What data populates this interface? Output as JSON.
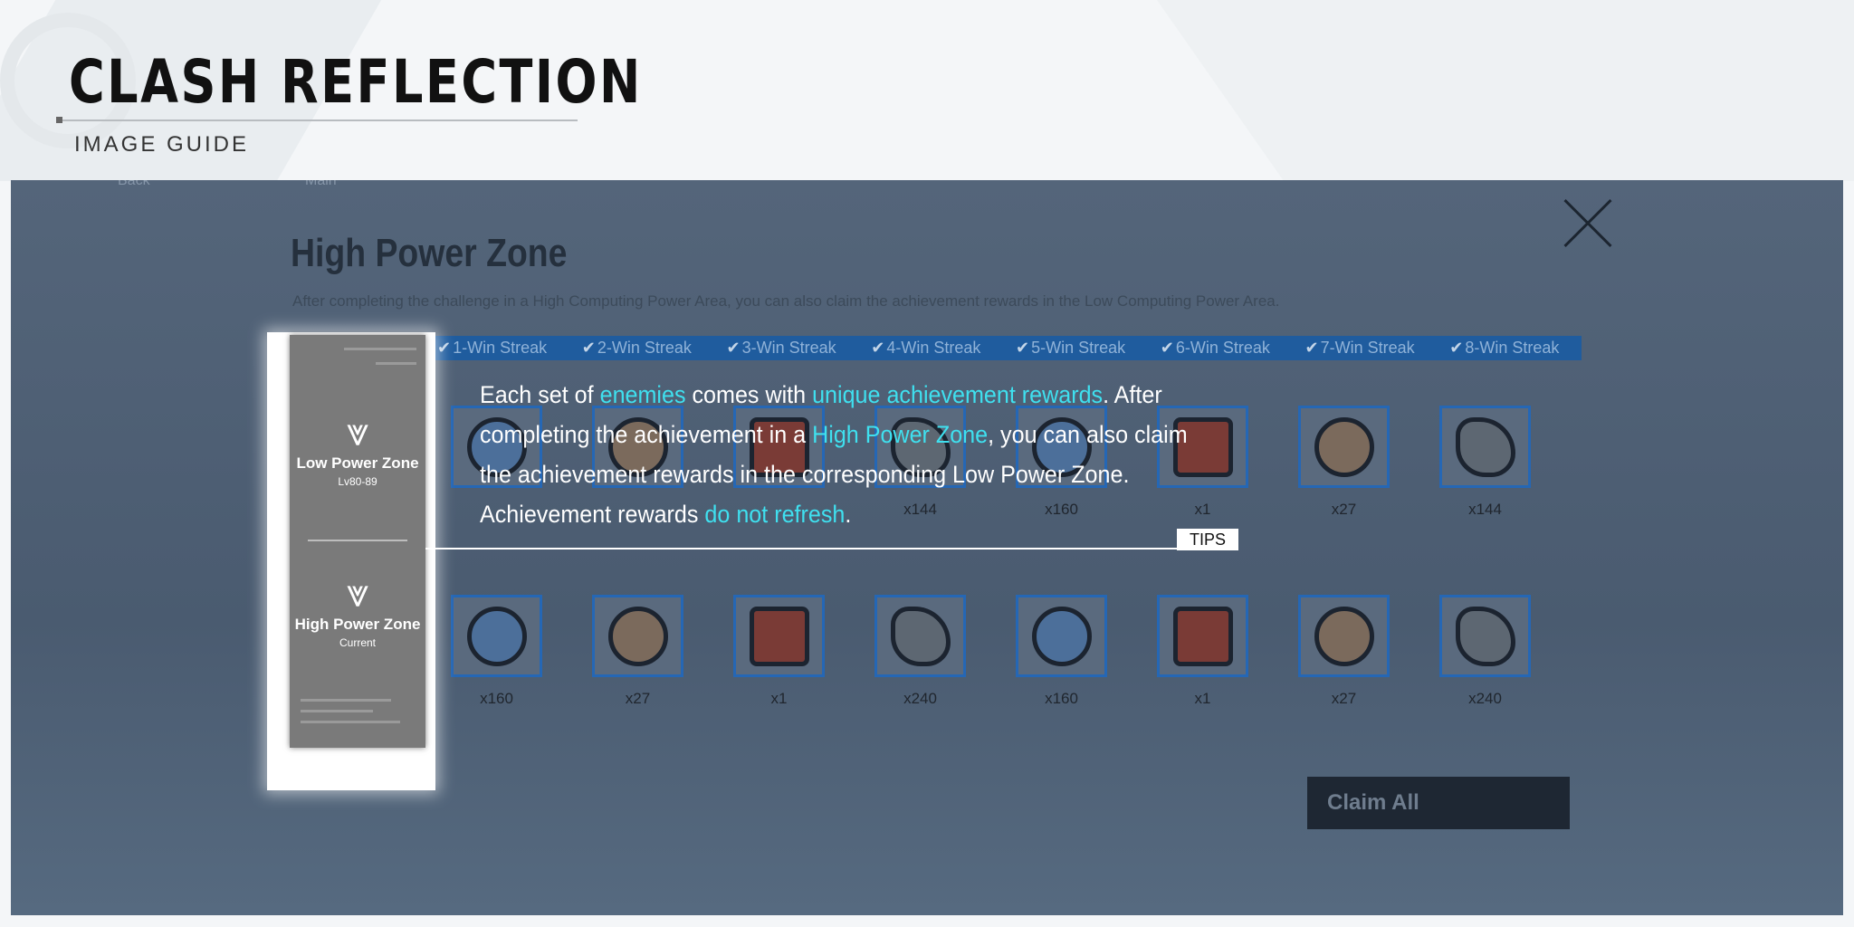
{
  "header": {
    "title": "CLASH REFLECTION",
    "subtitle": "IMAGE GUIDE"
  },
  "game": {
    "topbar": {
      "back_label": "Back",
      "main_label": "Main"
    },
    "zone_title": "High Power Zone",
    "zone_description": "After completing the challenge in a High Computing Power Area, you can also claim the achievement rewards in the Low Computing Power Area.",
    "streak_tabs": [
      "1-Win Streak",
      "2-Win Streak",
      "3-Win Streak",
      "4-Win Streak",
      "5-Win Streak",
      "6-Win Streak",
      "7-Win Streak",
      "8-Win Streak"
    ],
    "reward_row_1": [
      {
        "qty": "",
        "kind": "blue"
      },
      {
        "qty": "",
        "kind": "orange"
      },
      {
        "qty": "",
        "kind": "red"
      },
      {
        "qty": "x144",
        "kind": "grey"
      },
      {
        "qty": "x160",
        "kind": "blue"
      },
      {
        "qty": "x1",
        "kind": "red"
      },
      {
        "qty": "x27",
        "kind": "orange"
      },
      {
        "qty": "x144",
        "kind": "grey"
      }
    ],
    "reward_row_2": [
      {
        "qty": "x160",
        "kind": "blue"
      },
      {
        "qty": "x27",
        "kind": "orange"
      },
      {
        "qty": "x1",
        "kind": "red"
      },
      {
        "qty": "x240",
        "kind": "grey"
      },
      {
        "qty": "x160",
        "kind": "blue"
      },
      {
        "qty": "x1",
        "kind": "red"
      },
      {
        "qty": "x27",
        "kind": "orange"
      },
      {
        "qty": "x240",
        "kind": "grey"
      }
    ],
    "claim_all_label": "Claim All",
    "zones": [
      {
        "name": "Low Power Zone",
        "sub": "Lv80-89"
      },
      {
        "name": "High Power Zone",
        "sub": "Current"
      }
    ]
  },
  "tips": {
    "tag": "TIPS",
    "p1": "Each set of ",
    "h1": "enemies",
    "p2": " comes with ",
    "h2": "unique achievement rewards",
    "p3": ". After completing the achievement in a ",
    "h3": "High Power Zone",
    "p4": ", you can also claim the achievement rewards in the corresponding Low Power Zone. Achievement rewards ",
    "h4": "do not refresh",
    "p5": "."
  },
  "colors": {
    "highlight": "#3fe0ef",
    "tab_blue": "#1f5c9e"
  }
}
